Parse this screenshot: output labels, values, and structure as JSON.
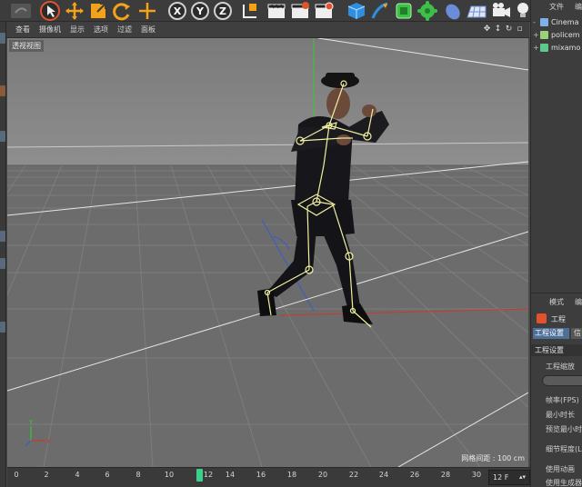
{
  "viewport": {
    "menu": [
      "查看",
      "摄像机",
      "显示",
      "选项",
      "过滤",
      "面板"
    ],
    "view_name": "透视视图",
    "grid_spacing": "网格间距 : 100 cm"
  },
  "timeline": {
    "ticks": [
      "0",
      "2",
      "4",
      "6",
      "8",
      "10",
      "12",
      "14",
      "16",
      "18",
      "20",
      "22",
      "24",
      "26",
      "28",
      "30"
    ],
    "current_frame": "12",
    "end_frame_field": "12 F"
  },
  "object_manager": {
    "menu": [
      "文件",
      "编"
    ],
    "objects": [
      {
        "name": "Cinema",
        "icon_color": "#7fb0e8"
      },
      {
        "name": "policem",
        "icon_color": "#9ad07a"
      },
      {
        "name": "mixamo",
        "icon_color": "#5cc88a"
      }
    ]
  },
  "attributes": {
    "menu": [
      "模式",
      "编"
    ],
    "title": "工程",
    "tab_active": "工程设置",
    "tab_other": "信",
    "section": "工程设置",
    "rows": [
      "工程缩放",
      "帧率(FPS)",
      "最小时长",
      "预览最小时",
      "细节程度(L",
      "使用动画",
      "使用生成器"
    ]
  },
  "colors": {
    "viewport_bg": "#8a8a8a",
    "accent_blue": "#4e6f97",
    "frame_marker": "#3ad08a",
    "axis_red": "#c83a2a",
    "axis_green": "#38c838",
    "skeleton": "#f0f0a0"
  },
  "icons": [
    "undo-icon",
    "select-arrow-icon",
    "move-icon",
    "scale-icon",
    "rotate-icon",
    "axis-lock-icon",
    "coordinate-icon",
    "render-view-icon",
    "render-picture-icon",
    "render-settings-icon",
    "cube-icon",
    "pen-icon",
    "subdivision-icon",
    "deformer-icon",
    "floor-icon",
    "camera-icon",
    "light-icon"
  ]
}
